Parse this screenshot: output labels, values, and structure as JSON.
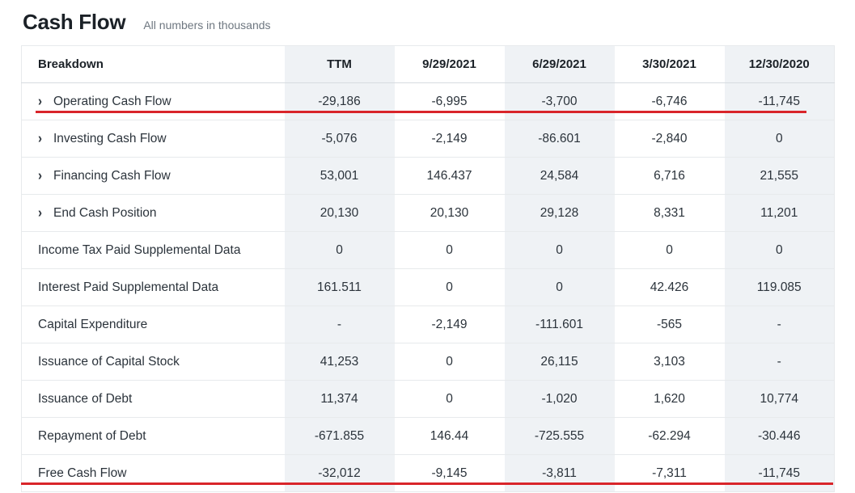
{
  "header": {
    "title": "Cash Flow",
    "subtitle": "All numbers in thousands"
  },
  "accent_colors": {
    "highlight_rule": "#d9252a",
    "band_background": "#eff2f5",
    "row_divider": "#e7eaec",
    "text": "#2b333b"
  },
  "table": {
    "columns": [
      {
        "key": "breakdown",
        "label": "Breakdown",
        "align": "left",
        "band": false
      },
      {
        "key": "ttm",
        "label": "TTM",
        "align": "center",
        "band": true
      },
      {
        "key": "q1",
        "label": "9/29/2021",
        "align": "center",
        "band": false
      },
      {
        "key": "q2",
        "label": "6/29/2021",
        "align": "center",
        "band": true
      },
      {
        "key": "q3",
        "label": "3/30/2021",
        "align": "center",
        "band": false
      },
      {
        "key": "q4",
        "label": "12/30/2020",
        "align": "center",
        "band": true
      }
    ],
    "rows": [
      {
        "label": "Operating Cash Flow",
        "expandable": true,
        "chevron": "›",
        "highlighted": true,
        "values": [
          "-29,186",
          "-6,995",
          "-3,700",
          "-6,746",
          "-11,745"
        ]
      },
      {
        "label": "Investing Cash Flow",
        "expandable": true,
        "chevron": "›",
        "highlighted": false,
        "values": [
          "-5,076",
          "-2,149",
          "-86.601",
          "-2,840",
          "0"
        ]
      },
      {
        "label": "Financing Cash Flow",
        "expandable": true,
        "chevron": "›",
        "highlighted": false,
        "values": [
          "53,001",
          "146.437",
          "24,584",
          "6,716",
          "21,555"
        ]
      },
      {
        "label": "End Cash Position",
        "expandable": true,
        "chevron": "›",
        "highlighted": false,
        "values": [
          "20,130",
          "20,130",
          "29,128",
          "8,331",
          "11,201"
        ]
      },
      {
        "label": "Income Tax Paid Supplemental Data",
        "expandable": false,
        "chevron": "",
        "highlighted": false,
        "values": [
          "0",
          "0",
          "0",
          "0",
          "0"
        ]
      },
      {
        "label": "Interest Paid Supplemental Data",
        "expandable": false,
        "chevron": "",
        "highlighted": false,
        "values": [
          "161.511",
          "0",
          "0",
          "42.426",
          "119.085"
        ]
      },
      {
        "label": "Capital Expenditure",
        "expandable": false,
        "chevron": "",
        "highlighted": false,
        "values": [
          "-",
          "-2,149",
          "-111.601",
          "-565",
          "-"
        ]
      },
      {
        "label": "Issuance of Capital Stock",
        "expandable": false,
        "chevron": "",
        "highlighted": false,
        "values": [
          "41,253",
          "0",
          "26,115",
          "3,103",
          "-"
        ]
      },
      {
        "label": "Issuance of Debt",
        "expandable": false,
        "chevron": "",
        "highlighted": false,
        "values": [
          "11,374",
          "0",
          "-1,020",
          "1,620",
          "10,774"
        ]
      },
      {
        "label": "Repayment of Debt",
        "expandable": false,
        "chevron": "",
        "highlighted": false,
        "values": [
          "-671.855",
          "146.44",
          "-725.555",
          "-62.294",
          "-30.446"
        ]
      },
      {
        "label": "Free Cash Flow",
        "expandable": false,
        "chevron": "",
        "highlighted": true,
        "values": [
          "-32,012",
          "-9,145",
          "-3,811",
          "-7,311",
          "-11,745"
        ]
      }
    ]
  }
}
